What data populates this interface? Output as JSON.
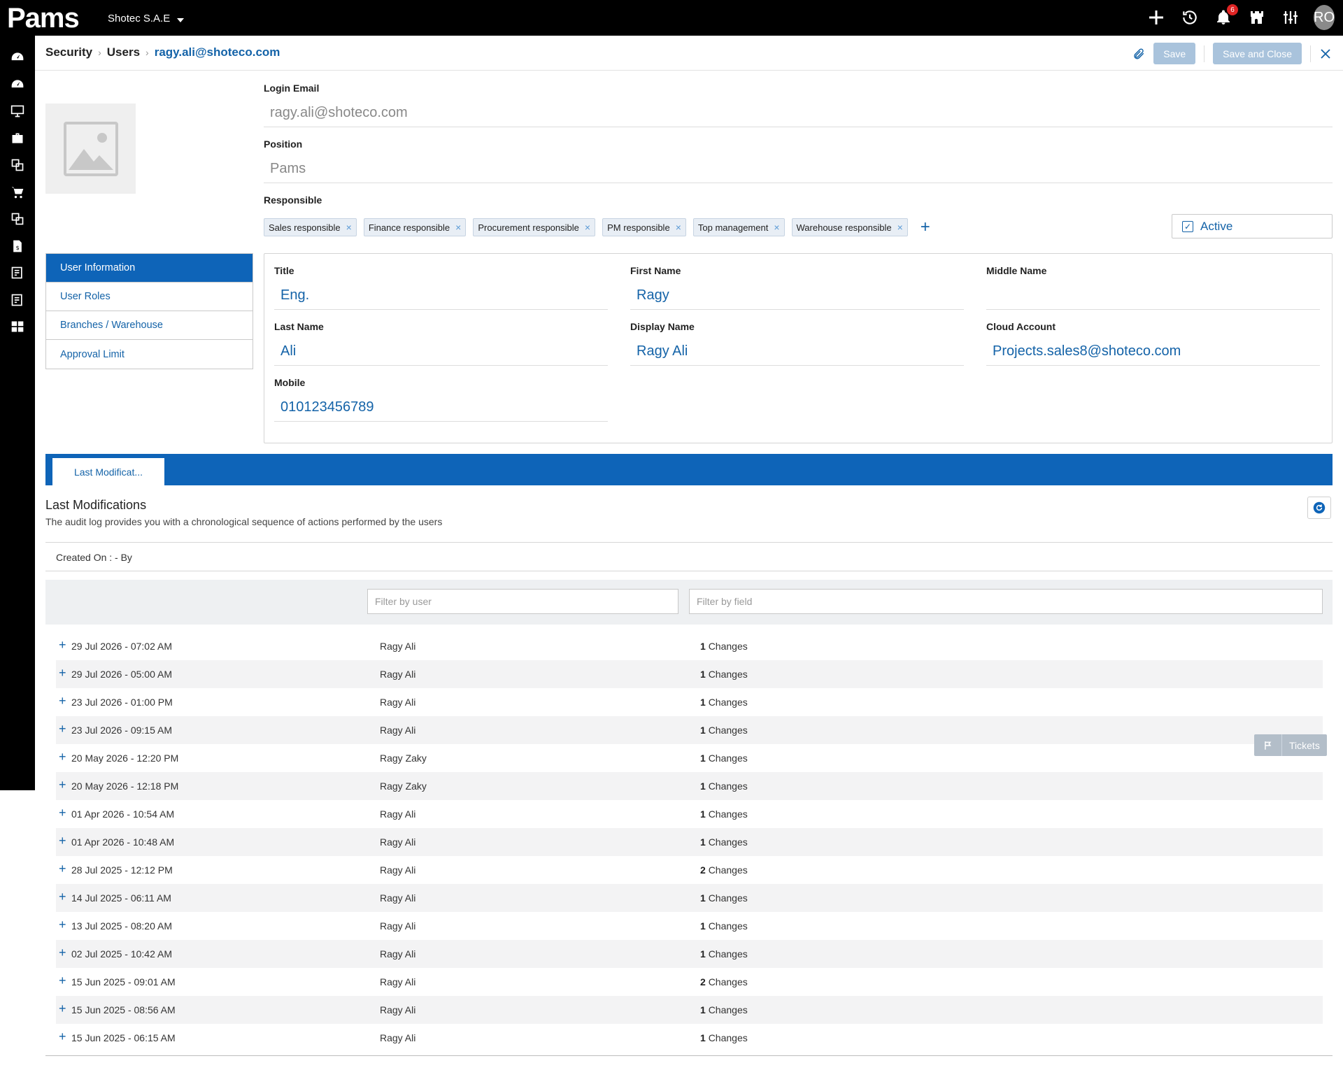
{
  "app": {
    "logo": "Pams",
    "company": "Shotec S.A.E"
  },
  "topbar": {
    "notification_count": "6",
    "avatar_initials": "RO"
  },
  "breadcrumb": {
    "items": [
      "Security",
      "Users"
    ],
    "current": "ragy.ali@shoteco.com"
  },
  "header": {
    "save_label": "Save",
    "save_close_label": "Save and Close"
  },
  "user": {
    "login_email_label": "Login Email",
    "login_email": "ragy.ali@shoteco.com",
    "position_label": "Position",
    "position": "Pams",
    "responsible_label": "Responsible",
    "responsible": [
      "Sales responsible",
      "Finance responsible",
      "Procurement responsible",
      "PM responsible",
      "Top management",
      "Warehouse responsible"
    ],
    "active_label": "Active"
  },
  "left_menu": [
    "User Information",
    "User Roles",
    "Branches / Warehouse",
    "Approval Limit"
  ],
  "info": {
    "title_label": "Title",
    "title": "Eng.",
    "first_name_label": "First Name",
    "first_name": "Ragy",
    "middle_name_label": "Middle Name",
    "middle_name": "",
    "last_name_label": "Last Name",
    "last_name": "Ali",
    "display_name_label": "Display Name",
    "display_name": "Ragy Ali",
    "cloud_account_label": "Cloud Account",
    "cloud_account": "Projects.sales8@shoteco.com",
    "mobile_label": "Mobile",
    "mobile": "010123456789"
  },
  "tabs": {
    "last_mod": "Last Modificat..."
  },
  "audit": {
    "title": "Last Modifications",
    "description": "The audit log provides you with a chronological sequence of actions performed by the users",
    "created_on": "Created On : - By",
    "filter_user_placeholder": "Filter by user",
    "filter_field_placeholder": "Filter by field",
    "changes_label": "Changes",
    "rows": [
      {
        "date": "29 Jul 2026 - 07:02 AM",
        "user": "Ragy Ali",
        "count": "1"
      },
      {
        "date": "29 Jul 2026 - 05:00 AM",
        "user": "Ragy Ali",
        "count": "1"
      },
      {
        "date": "23 Jul 2026 - 01:00 PM",
        "user": "Ragy Ali",
        "count": "1"
      },
      {
        "date": "23 Jul 2026 - 09:15 AM",
        "user": "Ragy Ali",
        "count": "1"
      },
      {
        "date": "20 May 2026 - 12:20 PM",
        "user": "Ragy Zaky",
        "count": "1"
      },
      {
        "date": "20 May 2026 - 12:18 PM",
        "user": "Ragy Zaky",
        "count": "1"
      },
      {
        "date": "01 Apr 2026 - 10:54 AM",
        "user": "Ragy Ali",
        "count": "1"
      },
      {
        "date": "01 Apr 2026 - 10:48 AM",
        "user": "Ragy Ali",
        "count": "1"
      },
      {
        "date": "28 Jul 2025 - 12:12 PM",
        "user": "Ragy Ali",
        "count": "2"
      },
      {
        "date": "14 Jul 2025 - 06:11 AM",
        "user": "Ragy Ali",
        "count": "1"
      },
      {
        "date": "13 Jul 2025 - 08:20 AM",
        "user": "Ragy Ali",
        "count": "1"
      },
      {
        "date": "02 Jul 2025 - 10:42 AM",
        "user": "Ragy Ali",
        "count": "1"
      },
      {
        "date": "15 Jun 2025 - 09:01 AM",
        "user": "Ragy Ali",
        "count": "2"
      },
      {
        "date": "15 Jun 2025 - 08:56 AM",
        "user": "Ragy Ali",
        "count": "1"
      },
      {
        "date": "15 Jun 2025 - 06:15 AM",
        "user": "Ragy Ali",
        "count": "1"
      }
    ]
  },
  "tickets_label": "Tickets",
  "colors": {
    "primary": "#0e64b8",
    "link": "#1463a8",
    "badge": "#e02424"
  }
}
